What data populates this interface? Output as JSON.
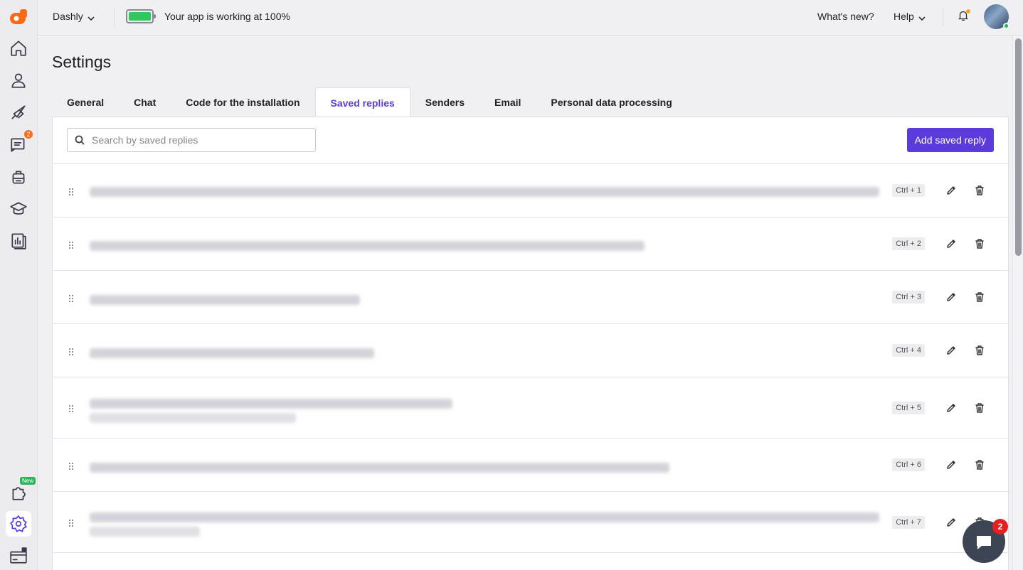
{
  "topbar": {
    "app_name": "Dashly",
    "status_text": "Your app is working at 100%",
    "whats_new": "What's new?",
    "help": "Help"
  },
  "sidebar": {
    "conversations_badge": "2",
    "new_badge": "New"
  },
  "page": {
    "title": "Settings"
  },
  "tabs": [
    {
      "label": "General"
    },
    {
      "label": "Chat"
    },
    {
      "label": "Code for the installation"
    },
    {
      "label": "Saved replies"
    },
    {
      "label": "Senders"
    },
    {
      "label": "Email"
    },
    {
      "label": "Personal data processing"
    }
  ],
  "active_tab": "Saved replies",
  "search": {
    "placeholder": "Search by saved replies"
  },
  "add_button": "Add saved reply",
  "replies": [
    {
      "shortcut": "Ctrl + 1"
    },
    {
      "shortcut": "Ctrl + 2"
    },
    {
      "shortcut": "Ctrl + 3"
    },
    {
      "shortcut": "Ctrl + 4"
    },
    {
      "shortcut": "Ctrl + 5"
    },
    {
      "shortcut": "Ctrl + 6"
    },
    {
      "shortcut": "Ctrl + 7"
    }
  ],
  "chat_widget": {
    "badge": "2"
  },
  "colors": {
    "accent": "#5b3bdb",
    "battery": "#2fc85a",
    "notification": "#f5a623",
    "chat_badge": "#e52020"
  }
}
